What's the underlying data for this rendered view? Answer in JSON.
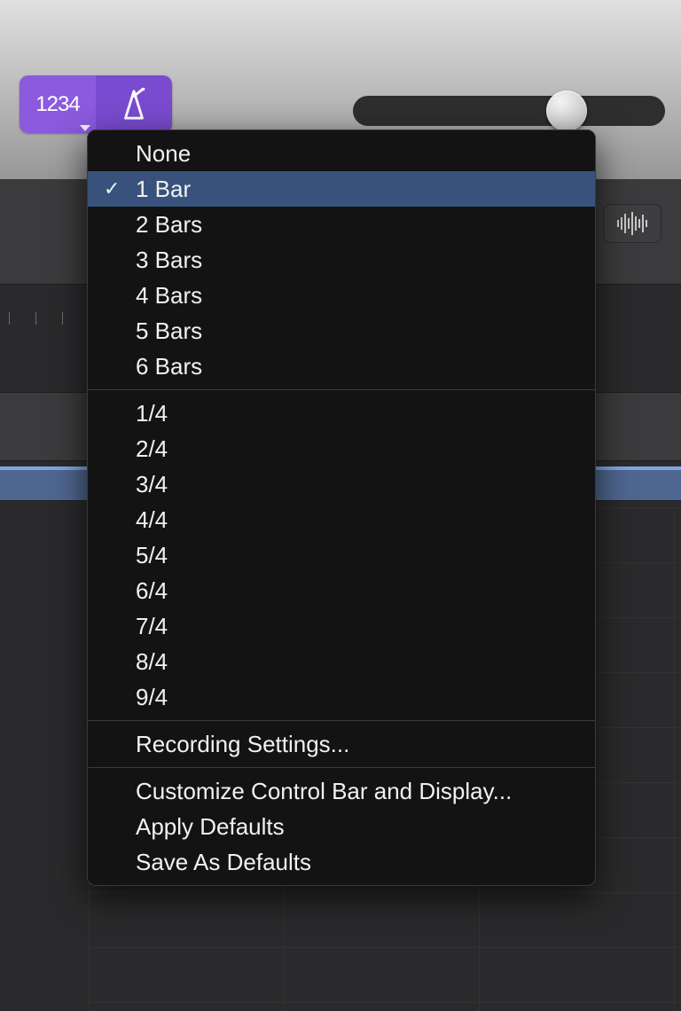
{
  "toolbar": {
    "countin_display": "1234",
    "slider_value": 0.64
  },
  "menu": {
    "group_bars": [
      {
        "label": "None",
        "selected": false
      },
      {
        "label": "1 Bar",
        "selected": true
      },
      {
        "label": "2 Bars",
        "selected": false
      },
      {
        "label": "3 Bars",
        "selected": false
      },
      {
        "label": "4 Bars",
        "selected": false
      },
      {
        "label": "5 Bars",
        "selected": false
      },
      {
        "label": "6 Bars",
        "selected": false
      }
    ],
    "group_beats": [
      {
        "label": "1/4"
      },
      {
        "label": "2/4"
      },
      {
        "label": "3/4"
      },
      {
        "label": "4/4"
      },
      {
        "label": "5/4"
      },
      {
        "label": "6/4"
      },
      {
        "label": "7/4"
      },
      {
        "label": "8/4"
      },
      {
        "label": "9/4"
      }
    ],
    "recording_settings": "Recording Settings...",
    "customize": "Customize Control Bar and Display...",
    "apply_defaults": "Apply Defaults",
    "save_defaults": "Save As Defaults"
  }
}
